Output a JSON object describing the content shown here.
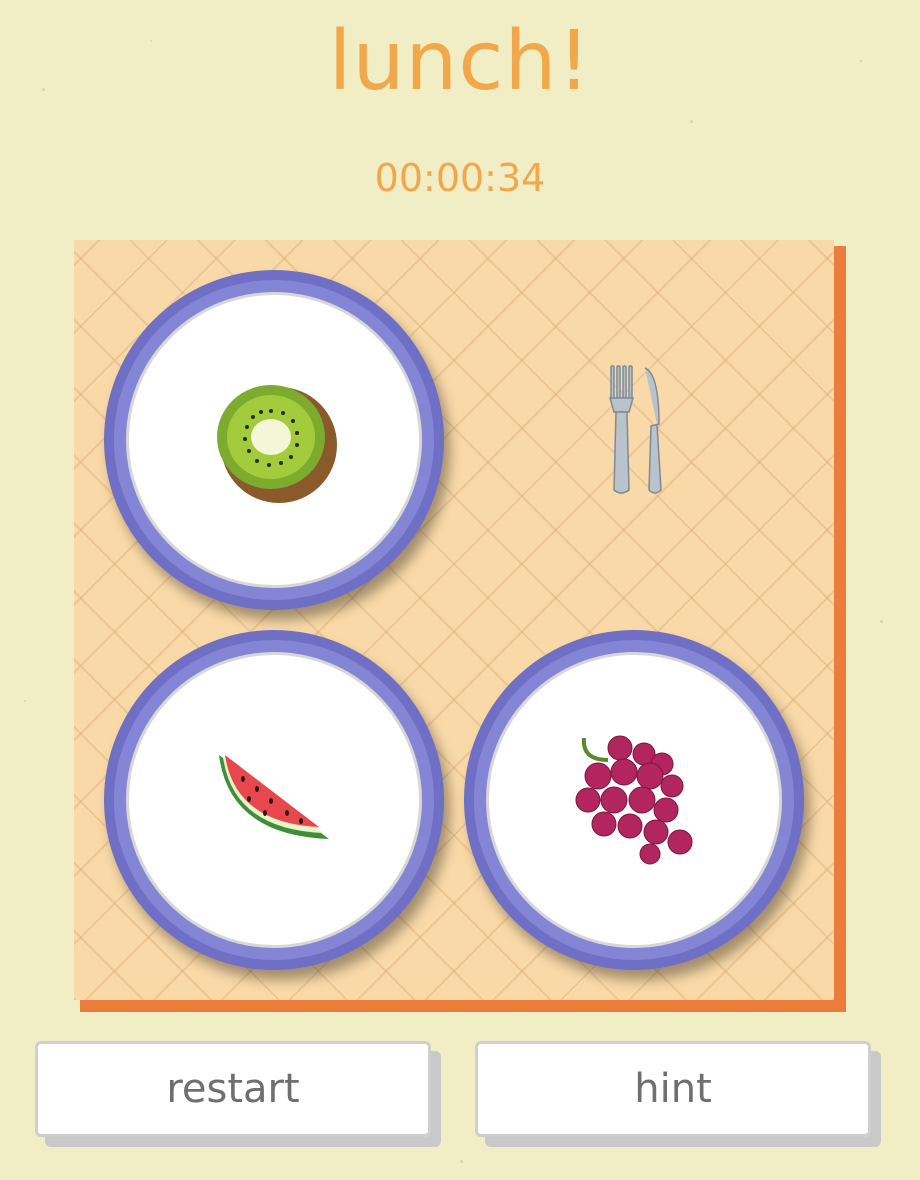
{
  "game": {
    "title": "lunch!",
    "timer": "00:00:34"
  },
  "board": {
    "colors": {
      "tablecloth": "#f9d9a7",
      "edge": "#ec7c3c",
      "plate_rim": "#6f6fc6"
    },
    "slots": [
      {
        "item": "kiwi"
      },
      {
        "item": "cutlery"
      },
      {
        "item": "watermelon"
      },
      {
        "item": "grapes"
      }
    ]
  },
  "buttons": {
    "restart_label": "restart",
    "hint_label": "hint"
  },
  "icons": {
    "kiwi": "kiwi-icon",
    "watermelon": "watermelon-icon",
    "grapes": "grapes-icon",
    "cutlery": "fork-and-knife-icon"
  }
}
